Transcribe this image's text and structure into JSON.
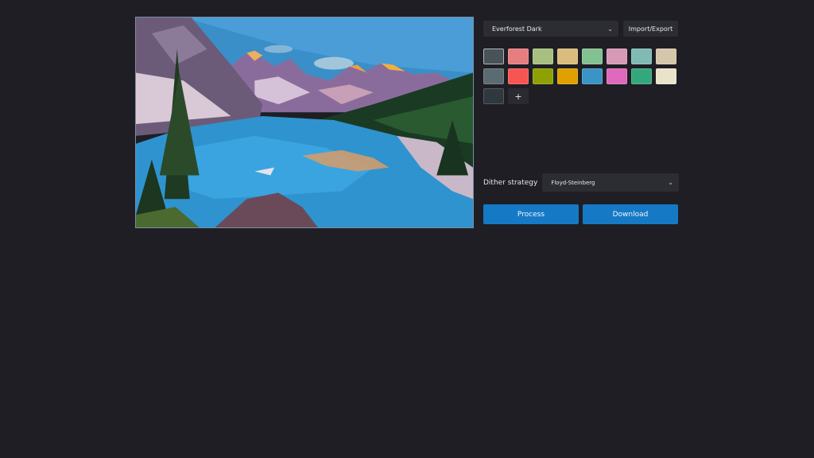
{
  "theme": {
    "selected": "Everforest Dark"
  },
  "toolbar": {
    "import_export_label": "Import/Export"
  },
  "palette": {
    "row1": [
      "#485257",
      "#e67e80",
      "#a7c080",
      "#dbbc7f",
      "#83c092",
      "#d699b6",
      "#7fbbb3",
      "#d3c6aa"
    ],
    "row2": [
      "#5c6a72",
      "#f85552",
      "#8da101",
      "#dfa000",
      "#3a94c5",
      "#df69ba",
      "#35a77c",
      "#e9e3cc"
    ],
    "row3": [
      "#2f383e"
    ],
    "add_label": "+"
  },
  "dither": {
    "label": "Dither strategy",
    "selected": "Floyd-Steinberg"
  },
  "actions": {
    "process_label": "Process",
    "download_label": "Download"
  }
}
